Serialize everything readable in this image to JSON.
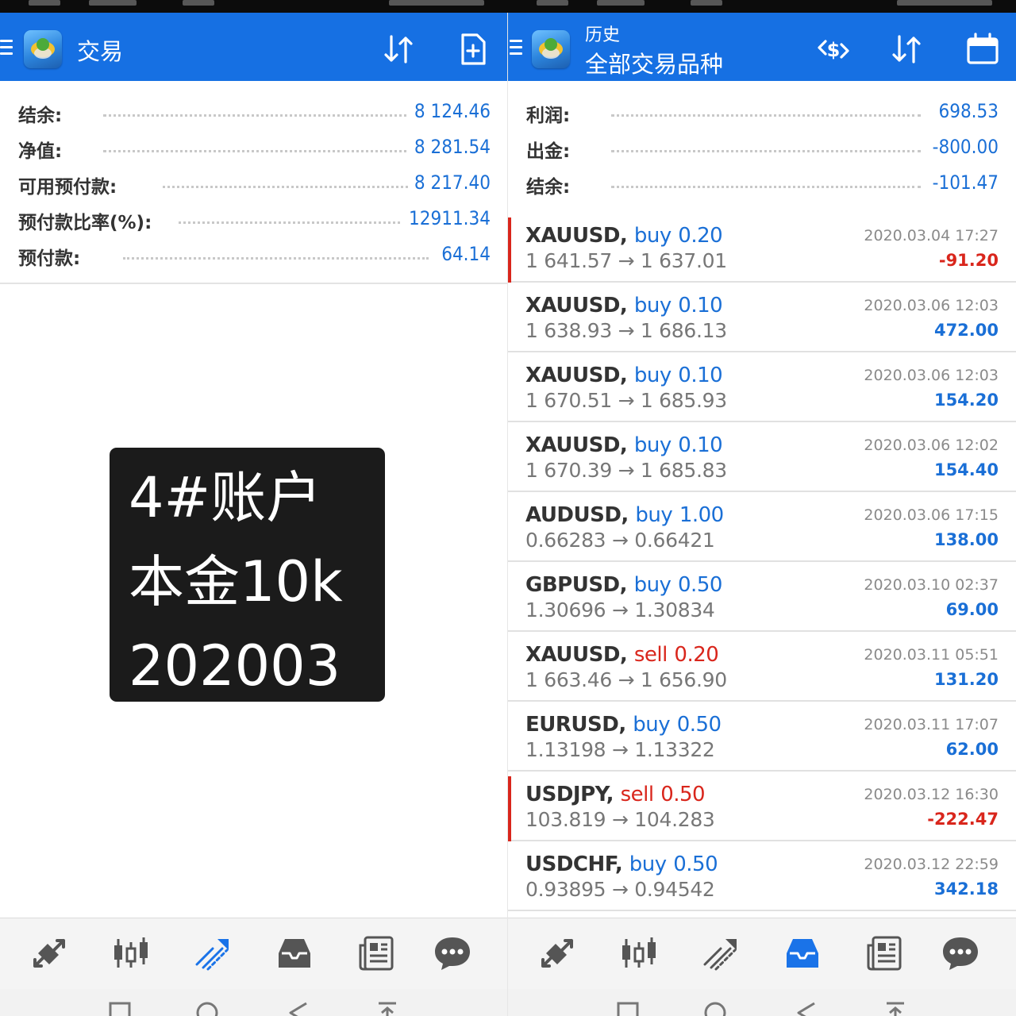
{
  "colors": {
    "appbar": "#1670e3",
    "value_blue": "#1a6fd6",
    "loss_red": "#d9261c",
    "label_dark": "#333333",
    "price_gray": "#777777"
  },
  "left": {
    "title": "交易",
    "toolbar_icons": [
      "sort-icon",
      "new-order-icon"
    ],
    "account": [
      {
        "label": "结余:",
        "value": "8 124.46"
      },
      {
        "label": "净值:",
        "value": "8 281.54"
      },
      {
        "label": "可用预付款:",
        "value": "8 217.40"
      },
      {
        "label": "预付款比率(%):",
        "value": "12911.34"
      },
      {
        "label": "预付款:",
        "value": "64.14"
      }
    ],
    "overlay": {
      "line1": "4#账户",
      "line2": "本金10k",
      "line3": "202003"
    },
    "nav": [
      "quotes-icon",
      "chart-icon",
      "trade-icon",
      "history-icon",
      "news-icon",
      "chat-icon"
    ],
    "nav_active": "trade-icon"
  },
  "right": {
    "subtitle": "历史",
    "title": "全部交易品种",
    "toolbar_icons": [
      "currency-filter-icon",
      "sort-icon",
      "calendar-icon"
    ],
    "summary": [
      {
        "label": "利润:",
        "value": "698.53"
      },
      {
        "label": "出金:",
        "value": "-800.00"
      },
      {
        "label": "结余:",
        "value": "-101.47"
      }
    ],
    "deals": [
      {
        "symbol": "XAUUSD,",
        "side": "buy",
        "volume": "0.20",
        "open": "1 641.57",
        "close": "1 637.01",
        "time": "2020.03.04 17:27",
        "profit": "-91.20",
        "loss": true
      },
      {
        "symbol": "XAUUSD,",
        "side": "buy",
        "volume": "0.10",
        "open": "1 638.93",
        "close": "1 686.13",
        "time": "2020.03.06 12:03",
        "profit": "472.00",
        "loss": false
      },
      {
        "symbol": "XAUUSD,",
        "side": "buy",
        "volume": "0.10",
        "open": "1 670.51",
        "close": "1 685.93",
        "time": "2020.03.06 12:03",
        "profit": "154.20",
        "loss": false
      },
      {
        "symbol": "XAUUSD,",
        "side": "buy",
        "volume": "0.10",
        "open": "1 670.39",
        "close": "1 685.83",
        "time": "2020.03.06 12:02",
        "profit": "154.40",
        "loss": false
      },
      {
        "symbol": "AUDUSD,",
        "side": "buy",
        "volume": "1.00",
        "open": "0.66283",
        "close": "0.66421",
        "time": "2020.03.06 17:15",
        "profit": "138.00",
        "loss": false
      },
      {
        "symbol": "GBPUSD,",
        "side": "buy",
        "volume": "0.50",
        "open": "1.30696",
        "close": "1.30834",
        "time": "2020.03.10 02:37",
        "profit": "69.00",
        "loss": false
      },
      {
        "symbol": "XAUUSD,",
        "side": "sell",
        "volume": "0.20",
        "open": "1 663.46",
        "close": "1 656.90",
        "time": "2020.03.11 05:51",
        "profit": "131.20",
        "loss": false
      },
      {
        "symbol": "EURUSD,",
        "side": "buy",
        "volume": "0.50",
        "open": "1.13198",
        "close": "1.13322",
        "time": "2020.03.11 17:07",
        "profit": "62.00",
        "loss": false
      },
      {
        "symbol": "USDJPY,",
        "side": "sell",
        "volume": "0.50",
        "open": "103.819",
        "close": "104.283",
        "time": "2020.03.12 16:30",
        "profit": "-222.47",
        "loss": true
      },
      {
        "symbol": "USDCHF,",
        "side": "buy",
        "volume": "0.50",
        "open": "0.93895",
        "close": "0.94542",
        "time": "2020.03.12 22:59",
        "profit": "342.18",
        "loss": false
      }
    ],
    "nav": [
      "quotes-icon",
      "chart-icon",
      "trade-icon",
      "history-icon",
      "news-icon",
      "chat-icon"
    ],
    "nav_active": "history-icon"
  },
  "system_nav": [
    "recent-apps-icon",
    "home-icon",
    "back-icon",
    "notification-icon"
  ]
}
